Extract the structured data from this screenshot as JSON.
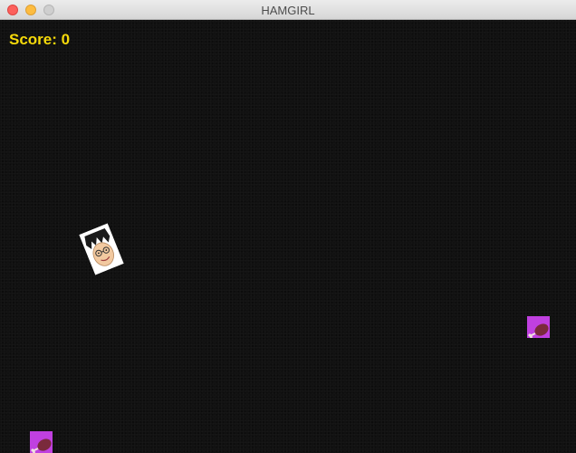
{
  "window": {
    "title": "HAMGIRL"
  },
  "hud": {
    "score_label": "Score: 0"
  },
  "colors": {
    "canvas_background": "#111111",
    "score_text": "#f5d90a",
    "pickup_fill": "#c040e0",
    "pickup_ham": "#7a2a3c"
  },
  "sprites": {
    "player_icon": "hamgirl-face-icon",
    "pickup_icon": "ham-leg-icon"
  }
}
